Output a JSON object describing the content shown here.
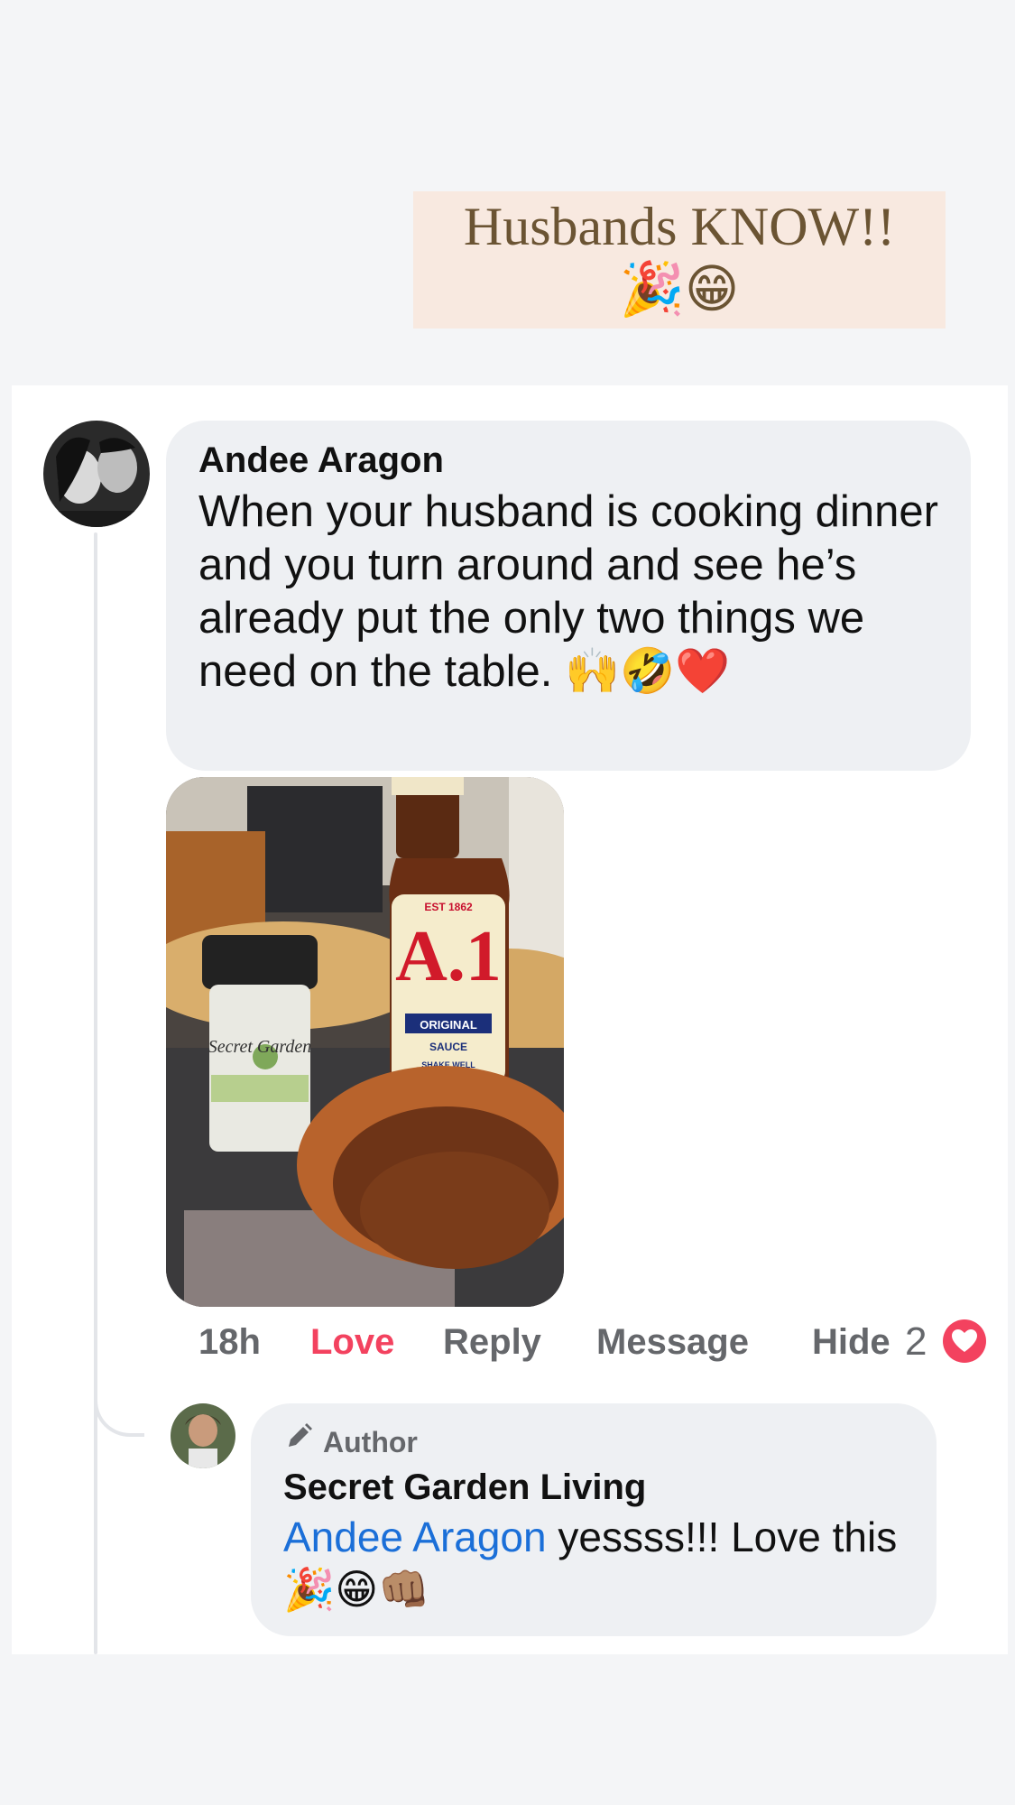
{
  "caption": {
    "text": "Husbands KNOW!!",
    "emoji": "🎉😁"
  },
  "comment": {
    "author": "Andee Aragon",
    "text": "When your husband is cooking dinner and you turn around and see he’s already put the only two things we need on the table. 🙌🤣❤️",
    "photo_labels": {
      "a1_est": "EST 1862",
      "a1_logo": "A.1",
      "a1_original": "ORIGINAL",
      "a1_sauce": "SAUCE",
      "a1_shake": "SHAKE WELL",
      "jar_brand": "Secret Garden"
    }
  },
  "actions": {
    "time": "18h",
    "love": "Love",
    "reply": "Reply",
    "message": "Message",
    "hide": "Hide",
    "reaction_count": "2"
  },
  "reply": {
    "badge": "Author",
    "author": "Secret Garden Living",
    "mention": "Andee Aragon",
    "text": " yessss!!! Love this 🎉😁👊🏽"
  },
  "colors": {
    "love_red": "#f3425f",
    "mention_blue": "#1b6fd8",
    "bubble_gray": "#eef0f3",
    "caption_bg": "#f8e9e0"
  },
  "icons": [
    "pencil-icon",
    "heart-reaction-icon"
  ]
}
